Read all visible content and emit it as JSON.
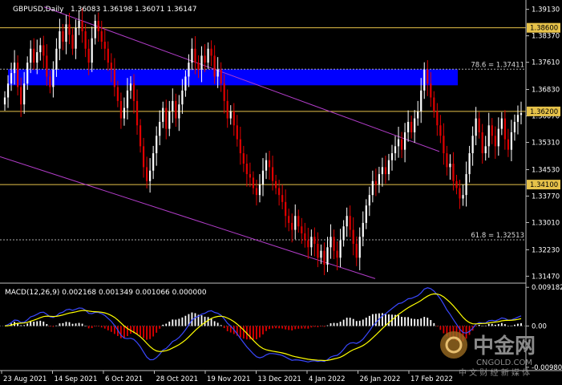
{
  "chart_data": {
    "type": "candlestick",
    "symbol_label": "GBPUSD,Daily",
    "ohlc_label": "1.36083 1.36198 1.36071 1.36147",
    "price_ticks": [
      "1.39130",
      "1.38370",
      "1.37610",
      "1.36830",
      "1.36070",
      "1.35310",
      "1.34530",
      "1.33770",
      "1.33010",
      "1.32230",
      "1.31470"
    ],
    "price_range": [
      1.3134,
      1.3926
    ],
    "level_tags": [
      {
        "value": 1.386,
        "label": "1.38600"
      },
      {
        "value": 1.362,
        "label": "1.36200"
      },
      {
        "value": 1.341,
        "label": "1.34100"
      }
    ],
    "fib_levels": [
      {
        "value": 1.37411,
        "label": "78.6 = 1.37411"
      },
      {
        "value": 1.32513,
        "label": "61.8 = 1.32513"
      }
    ],
    "resistance_zone": [
      1.3695,
      1.3741
    ],
    "date_labels": [
      "23 Aug 2021",
      "14 Sep 2021",
      "6 Oct 2021",
      "28 Oct 2021",
      "19 Nov 2021",
      "13 Dec 2021",
      "4 Jan 2022",
      "26 Jan 2022",
      "17 Feb 2022"
    ],
    "closes": [
      1.366,
      1.37,
      1.373,
      1.376,
      1.369,
      1.364,
      1.37,
      1.376,
      1.38,
      1.376,
      1.379,
      1.381,
      1.378,
      1.372,
      1.369,
      1.374,
      1.38,
      1.385,
      1.382,
      1.387,
      1.384,
      1.38,
      1.386,
      1.388,
      1.385,
      1.38,
      1.376,
      1.383,
      1.388,
      1.385,
      1.382,
      1.38,
      1.376,
      1.374,
      1.369,
      1.365,
      1.36,
      1.363,
      1.368,
      1.37,
      1.365,
      1.358,
      1.352,
      1.346,
      1.342,
      1.345,
      1.35,
      1.355,
      1.359,
      1.363,
      1.357,
      1.362,
      1.365,
      1.36,
      1.364,
      1.368,
      1.372,
      1.376,
      1.38,
      1.376,
      1.374,
      1.378,
      1.376,
      1.38,
      1.378,
      1.372,
      1.374,
      1.37,
      1.365,
      1.36,
      1.362,
      1.358,
      1.354,
      1.35,
      1.347,
      1.344,
      1.343,
      1.34,
      1.338,
      1.341,
      1.345,
      1.348,
      1.346,
      1.342,
      1.34,
      1.338,
      1.336,
      1.332,
      1.33,
      1.328,
      1.332,
      1.329,
      1.327,
      1.325,
      1.323,
      1.326,
      1.324,
      1.32,
      1.322,
      1.318,
      1.323,
      1.326,
      1.322,
      1.32,
      1.325,
      1.329,
      1.332,
      1.328,
      1.324,
      1.32,
      1.326,
      1.33,
      1.335,
      1.338,
      1.342,
      1.341,
      1.344,
      1.346,
      1.344,
      1.348,
      1.35,
      1.352,
      1.354,
      1.351,
      1.356,
      1.359,
      1.356,
      1.36,
      1.362,
      1.368,
      1.374,
      1.37,
      1.366,
      1.362,
      1.358,
      1.355,
      1.35,
      1.346,
      1.347,
      1.342,
      1.34,
      1.337,
      1.338,
      1.344,
      1.35,
      1.355,
      1.36,
      1.356,
      1.35,
      1.352,
      1.358,
      1.355,
      1.352,
      1.357,
      1.36,
      1.354,
      1.351,
      1.356,
      1.359,
      1.361,
      1.3615
    ],
    "macd_label": "MACD(12,26,9) 0.002168 0.001349 0.001066 0.000000",
    "macd_ticks": [
      "0.009182",
      "0.00",
      "-0.009806"
    ],
    "macd_range": [
      -0.0102,
      0.0096
    ],
    "colors": {
      "bull": "#ffffff",
      "bear": "#e00000",
      "zone": "#0000ff",
      "hline": "#e6c24a",
      "channel": "#b23dc9",
      "signal": "#ffff00",
      "macd_line": "#3a48ff",
      "hist_pos": "#ffffff",
      "hist_neg": "#e00000",
      "grid": "#7d7d7d"
    }
  },
  "watermark": {
    "brand": "中金网",
    "site": "CNGOLD.COM",
    "tagline": "中 文 财 经 新 媒 体"
  }
}
